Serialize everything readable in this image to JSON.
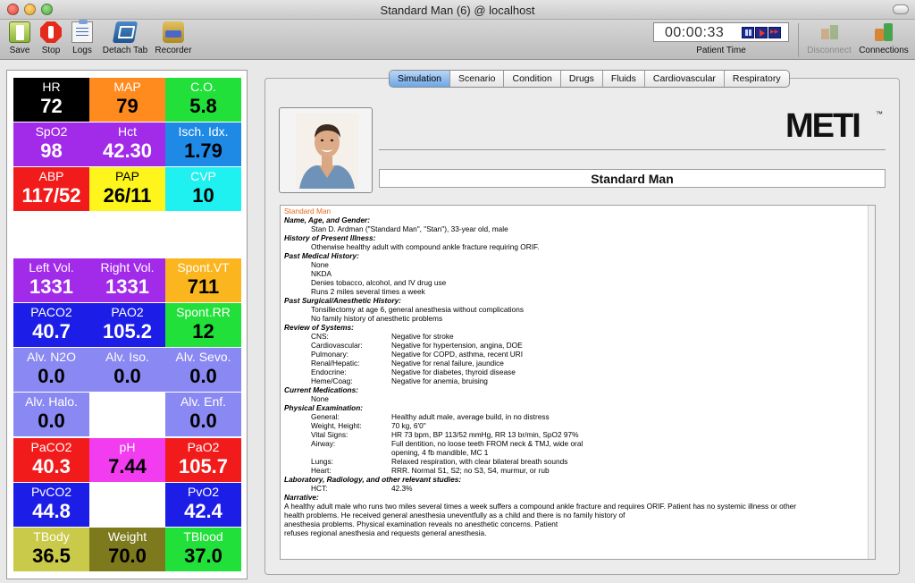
{
  "window": {
    "title": "Standard Man (6) @ localhost"
  },
  "toolbar": {
    "save": "Save",
    "stop": "Stop",
    "logs": "Logs",
    "detach": "Detach Tab",
    "recorder": "Recorder",
    "disconnect": "Disconnect",
    "connections": "Connections",
    "timer": "00:00:33",
    "timer_label": "Patient Time"
  },
  "vitals": [
    {
      "name": "HR",
      "value": "72",
      "color": "#000000"
    },
    {
      "name": "MAP",
      "value": "79",
      "color": "#ff8a1e"
    },
    {
      "name": "C.O.",
      "value": "5.8",
      "color": "#22e03a"
    },
    {
      "name": "SpO2",
      "value": "98",
      "color": "#a22bea"
    },
    {
      "name": "Hct",
      "value": "42.30",
      "color": "#a22bea"
    },
    {
      "name": "Isch. Idx.",
      "value": "1.79",
      "color": "#1e8ae6"
    },
    {
      "name": "ABP",
      "value": "117/52",
      "color": "#f21b1b"
    },
    {
      "name": "PAP",
      "value": "26/11",
      "color": "#fdf51c"
    },
    {
      "name": "CVP",
      "value": "10",
      "color": "#1ff0f0"
    },
    {
      "name": "Left Vol.",
      "value": "1331",
      "color": "#a22bea"
    },
    {
      "name": "Right Vol.",
      "value": "1331",
      "color": "#a22bea"
    },
    {
      "name": "Spont.VT",
      "value": "711",
      "color": "#fbb51e"
    },
    {
      "name": "PACO2",
      "value": "40.7",
      "color": "#1d1de8"
    },
    {
      "name": "PAO2",
      "value": "105.2",
      "color": "#1d1de8"
    },
    {
      "name": "Spont.RR",
      "value": "12",
      "color": "#22e03a"
    },
    {
      "name": "Alv. N2O",
      "value": "0.0",
      "color": "#8a88f2"
    },
    {
      "name": "Alv. Iso.",
      "value": "0.0",
      "color": "#8a88f2"
    },
    {
      "name": "Alv. Sevo.",
      "value": "0.0",
      "color": "#8a88f2"
    },
    {
      "name": "Alv. Halo.",
      "value": "0.0",
      "color": "#8a88f2"
    },
    {
      "name": "Alv. Enf.",
      "value": "0.0",
      "color": "#8a88f2"
    },
    {
      "name": "PaCO2",
      "value": "40.3",
      "color": "#f21b1b"
    },
    {
      "name": "pH",
      "value": "7.44",
      "color": "#f23cf0"
    },
    {
      "name": "PaO2",
      "value": "105.7",
      "color": "#f21b1b"
    },
    {
      "name": "PvCO2",
      "value": "44.8",
      "color": "#1d1de8"
    },
    {
      "name": "PvO2",
      "value": "42.4",
      "color": "#1d1de8"
    },
    {
      "name": "TBody",
      "value": "36.5",
      "color": "#c9c94a"
    },
    {
      "name": "Weight",
      "value": "70.0",
      "color": "#7d7a1e"
    },
    {
      "name": "TBlood",
      "value": "37.0",
      "color": "#22e03a"
    }
  ],
  "tabs": [
    "Simulation",
    "Scenario",
    "Condition",
    "Drugs",
    "Fluids",
    "Cardiovascular",
    "Respiratory"
  ],
  "active_tab": "Simulation",
  "logo": "METI",
  "logo_tm": "™",
  "patient_name": "Standard Man",
  "document": {
    "title": "Standard Man",
    "name_h": "Name, Age, and Gender:",
    "name_v": "Stan D. Ardman (\"Standard Man\", \"Stan\"), 33-year old, male",
    "hpi_h": "History of Present Illness:",
    "hpi_v": "Otherwise healthy adult with compound ankle fracture requiring ORIF.",
    "pmh_h": "Past Medical History:",
    "pmh": [
      "None",
      "NKDA",
      "Denies tobacco, alcohol, and IV drug use",
      "Runs 2 miles several times a week"
    ],
    "psh_h": "Past Surgical/Anesthetic History:",
    "psh": [
      "Tonsillectomy at age 6, general anesthesia without complications",
      "No family history of anesthetic problems"
    ],
    "ros_h": "Review of Systems:",
    "ros": [
      {
        "k": "CNS:",
        "v": "Negative for stroke"
      },
      {
        "k": "Cardiovascular:",
        "v": "Negative for hypertension, angina, DOE"
      },
      {
        "k": "Pulmonary:",
        "v": "Negative for COPD, asthma, recent URI"
      },
      {
        "k": "Renal/Hepatic:",
        "v": "Negative for renal failure, jaundice"
      },
      {
        "k": "Endocrine:",
        "v": "Negative for diabetes, thyroid disease"
      },
      {
        "k": "Heme/Coag:",
        "v": "Negative for anemia, bruising"
      }
    ],
    "meds_h": "Current Medications:",
    "meds_v": "None",
    "pe_h": "Physical Examination:",
    "pe": [
      {
        "k": "General:",
        "v": "Healthy adult male, average build, in no distress"
      },
      {
        "k": "Weight, Height:",
        "v": "70 kg, 6'0\""
      },
      {
        "k": "Vital Signs:",
        "v": "HR 73 bpm, BP 113/52 mmHg, RR 13 br/min, SpO2 97%"
      },
      {
        "k": "Airway:",
        "v": "Full dentition, no loose teeth FROM neck & TMJ, wide oral"
      },
      {
        "k": "",
        "v": "opening, 4 fb mandible, MC 1"
      },
      {
        "k": "Lungs:",
        "v": "Relaxed respiration, with clear bilateral breath sounds"
      },
      {
        "k": "Heart:",
        "v": "RRR. Normal S1, S2; no S3, S4, murmur, or rub"
      }
    ],
    "lab_h": "Laboratory, Radiology, and other relevant studies:",
    "lab": [
      {
        "k": "HCT:",
        "v": "42.3%"
      }
    ],
    "narr_h": "Narrative:",
    "narr": [
      "A healthy adult male who runs two miles several times a week suffers a compound ankle fracture and requires ORIF.  Patient has no systemic illness or other",
      "health problems.  He received general anesthesia uneventfully as a child and there is no family history of",
      "anesthesia problems.  Physical examination reveals no anesthetic concerns.  Patient",
      "refuses regional anesthesia and requests general anesthesia."
    ]
  }
}
